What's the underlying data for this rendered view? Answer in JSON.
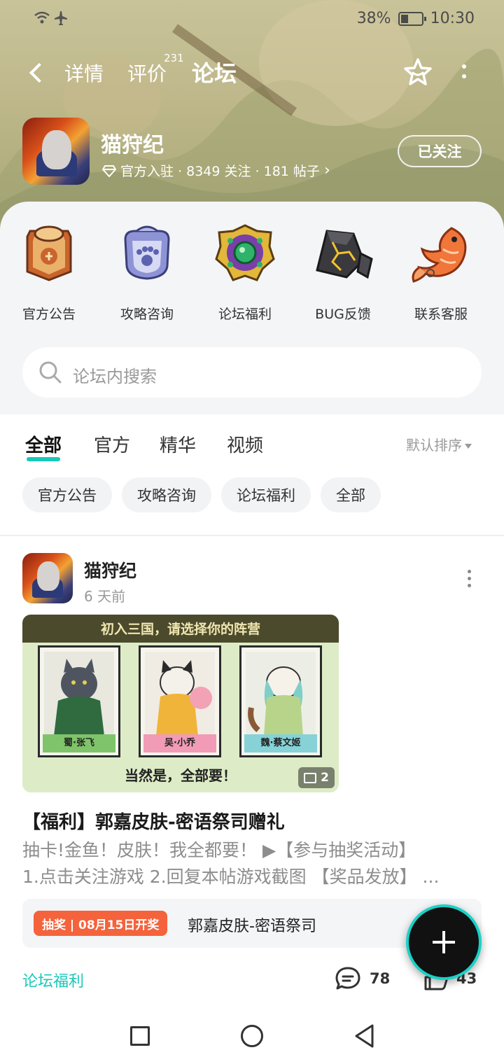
{
  "status_bar": {
    "battery": "38%",
    "time": "10:30"
  },
  "header": {
    "tabs": [
      {
        "label": "详情"
      },
      {
        "label": "评价",
        "badge": "231"
      },
      {
        "label": "论坛",
        "active": true
      }
    ]
  },
  "game": {
    "name": "猫狩纪",
    "meta": "官方入驻 · 8349 关注 · 181 帖子",
    "follow_label": "已关注"
  },
  "entries": [
    {
      "label": "官方公告",
      "icon": "announcement-badge-icon"
    },
    {
      "label": "攻略咨询",
      "icon": "paw-shield-icon"
    },
    {
      "label": "论坛福利",
      "icon": "gem-medallion-icon"
    },
    {
      "label": "BUG反馈",
      "icon": "cracked-stone-icon"
    },
    {
      "label": "联系客服",
      "icon": "koi-fish-icon"
    }
  ],
  "search": {
    "placeholder": "论坛内搜索"
  },
  "filter_tabs": [
    {
      "label": "全部",
      "active": true
    },
    {
      "label": "官方"
    },
    {
      "label": "精华"
    },
    {
      "label": "视频"
    }
  ],
  "sort_label": "默认排序",
  "chips": [
    "官方公告",
    "攻略咨询",
    "论坛福利",
    "全部"
  ],
  "post": {
    "author": "猫狩纪",
    "time": "6 天前",
    "image": {
      "headline": "初入三国，请选择你的阵营",
      "cards": [
        "蜀·张飞",
        "吴·小乔",
        "魏·蔡文姬"
      ],
      "footer": "当然是，全部要！",
      "count": "2"
    },
    "title": "【福利】郭嘉皮肤-密语祭司赠礼",
    "body_line1": "抽卡!金鱼！皮肤！我全都要！ ▶【参与抽奖活动】",
    "body_line2": "1.点击关注游戏 2.回复本帖游戏截图 【奖品发放】 ...",
    "lottery_badge": "抽奖 | 08月15日开奖",
    "lottery_text": "郭嘉皮肤-密语祭司",
    "tag": "论坛福利",
    "comments": "78",
    "likes": "43"
  },
  "colors": {
    "accent": "#19c8b8",
    "lottery": "#f4633c"
  }
}
